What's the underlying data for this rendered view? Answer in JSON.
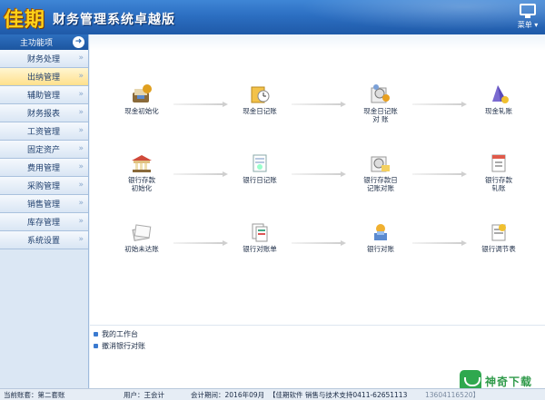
{
  "header": {
    "logo": "佳期",
    "title": "财务管理系统卓越版",
    "menu_label": "菜单 ▾"
  },
  "sidebar": {
    "heading": "主功能项",
    "items": [
      {
        "label": "财务处理"
      },
      {
        "label": "出纳管理",
        "active": true
      },
      {
        "label": "辅助管理"
      },
      {
        "label": "财务报表"
      },
      {
        "label": "工资管理"
      },
      {
        "label": "固定资产"
      },
      {
        "label": "费用管理"
      },
      {
        "label": "采购管理"
      },
      {
        "label": "销售管理"
      },
      {
        "label": "库存管理"
      },
      {
        "label": "系统设置"
      }
    ]
  },
  "flow": {
    "row1": [
      {
        "label": "现金初始化",
        "icon": "cash-init-icon"
      },
      {
        "label": "现金日记账",
        "icon": "cash-journal-icon"
      },
      {
        "label": "现金日记账\n对 账",
        "icon": "cash-reconcile-icon"
      },
      {
        "label": "现金轧账",
        "icon": "cash-close-icon"
      }
    ],
    "row2": [
      {
        "label": "银行存款\n初始化",
        "icon": "bank-init-icon"
      },
      {
        "label": "银行日记账",
        "icon": "bank-journal-icon"
      },
      {
        "label": "银行存款日\n记账对账",
        "icon": "bank-reconcile-icon"
      },
      {
        "label": "银行存款\n轧账",
        "icon": "bank-close-icon"
      }
    ],
    "row3": [
      {
        "label": "初始未达账",
        "icon": "initial-outstanding-icon"
      },
      {
        "label": "银行对账单",
        "icon": "bank-statement-icon"
      },
      {
        "label": "银行对账",
        "icon": "bank-match-icon"
      },
      {
        "label": "银行调节表",
        "icon": "bank-adjust-icon"
      }
    ]
  },
  "links": [
    {
      "label": "我的工作台"
    },
    {
      "label": "撤消银行对账"
    }
  ],
  "status": {
    "account_set": "当前账套：第二套账",
    "user": "用户：王会计",
    "period": "会计期间：2016年09月",
    "vendor": "【佳期软件 销售与技术支持0411-62651113",
    "phone": "13604116520】"
  },
  "watermark": "神奇下载"
}
